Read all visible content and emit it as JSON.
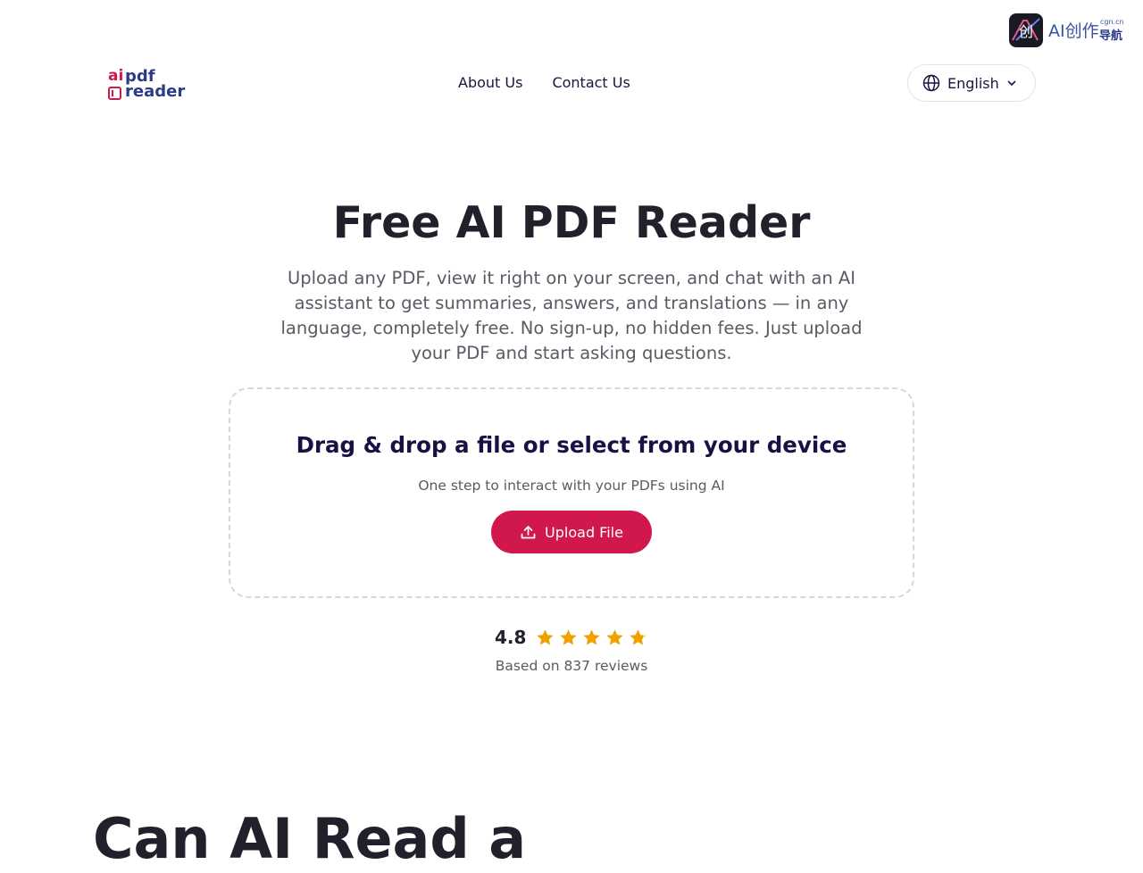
{
  "watermark": {
    "main": "AI创作",
    "sub_domain": "cgn.cn",
    "sub_label": "导航",
    "icon": "ai-creation-nav-icon"
  },
  "header": {
    "logo": {
      "ai": "ai",
      "pdf": "pdf",
      "reader": "reader"
    },
    "nav": [
      {
        "label": "About Us"
      },
      {
        "label": "Contact Us"
      }
    ],
    "language": {
      "label": "English",
      "icon": "globe-icon"
    }
  },
  "hero": {
    "title": "Free AI PDF Reader",
    "description": "Upload any PDF, view it right on your screen, and chat with an AI assistant to get summaries, answers, and translations — in any language, completely free. No sign-up, no hidden fees. Just upload your PDF and start asking questions."
  },
  "upload": {
    "title": "Drag & drop a file or select from your device",
    "subtitle": "One step to interact with your PDFs using AI",
    "button_label": "Upload File",
    "button_icon": "upload-icon"
  },
  "rating": {
    "score": "4.8",
    "stars": 5,
    "reviews_text": "Based on 837 reviews"
  },
  "section": {
    "title": "Can AI Read a"
  },
  "colors": {
    "brand_primary": "#d0184d",
    "brand_secondary": "#2d3a8a",
    "star": "#f0a100",
    "heading": "#22202a",
    "body_text": "#5a5a64"
  }
}
